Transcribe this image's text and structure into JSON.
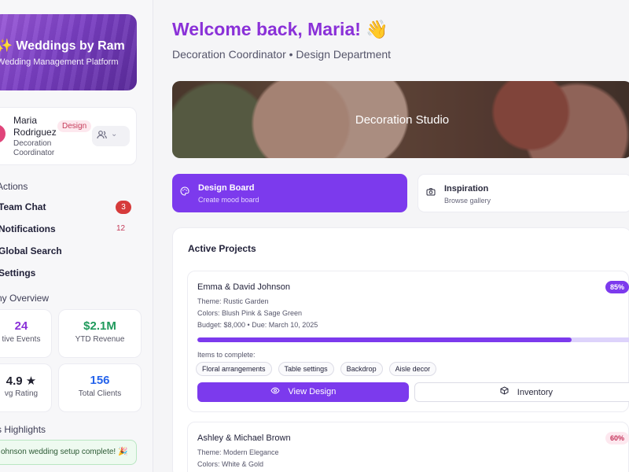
{
  "sidebar": {
    "brand_title": "✨ Weddings by Ram",
    "brand_subtitle": "Wedding Management Platform",
    "profile": {
      "name": "Maria Rodriguez",
      "role": "Decoration Coordinator",
      "badge": "Design",
      "switch_icon": "users-icon",
      "chevron": "⌄"
    },
    "actions_title": "Actions",
    "nav": [
      {
        "label": "Team Chat",
        "badge": "3"
      },
      {
        "label": "Notifications",
        "badge": "12"
      },
      {
        "label": "Global Search"
      },
      {
        "label": "Settings"
      }
    ],
    "overview_title": "ny Overview",
    "stats": [
      {
        "value": "24",
        "label": "tive Events",
        "color": "#8a31d8"
      },
      {
        "value": "$2.1M",
        "label": "YTD Revenue",
        "color": "#1f9a5c"
      },
      {
        "value": "4.9 ★",
        "label": "vg Rating",
        "color": "#1f1f2e"
      },
      {
        "value": "156",
        "label": "Total Clients",
        "color": "#2563eb"
      }
    ],
    "highlights_title": "s Highlights",
    "toast": "ohnson wedding setup complete! 🎉"
  },
  "main": {
    "welcome": "Welcome back, Maria! 👋",
    "subtitle": "Decoration Coordinator • Design Department",
    "hero_title": "Decoration Studio",
    "actions": [
      {
        "title": "Design Board",
        "subtitle": "Create mood board",
        "icon": "palette-icon"
      },
      {
        "title": "Inspiration",
        "subtitle": "Browse gallery",
        "icon": "camera-icon"
      }
    ],
    "projects_title": "Active Projects",
    "projects": [
      {
        "name": "Emma & David Johnson",
        "theme": "Theme: Rustic Garden",
        "colors": "Colors: Blush Pink & Sage Green",
        "budget": "Budget: $8,000 • Due: March 10, 2025",
        "progress_label": "85%",
        "progress": 0.85,
        "items_label": "Items to complete:",
        "items": [
          "Floral arrangements",
          "Table settings",
          "Backdrop",
          "Aisle decor"
        ],
        "view_label": "View Design",
        "inventory_label": "Inventory"
      },
      {
        "name": "Ashley & Michael Brown",
        "theme": "Theme: Modern Elegance",
        "colors": "Colors: White & Gold",
        "progress_label": "60%",
        "progress": 0.6
      }
    ]
  }
}
